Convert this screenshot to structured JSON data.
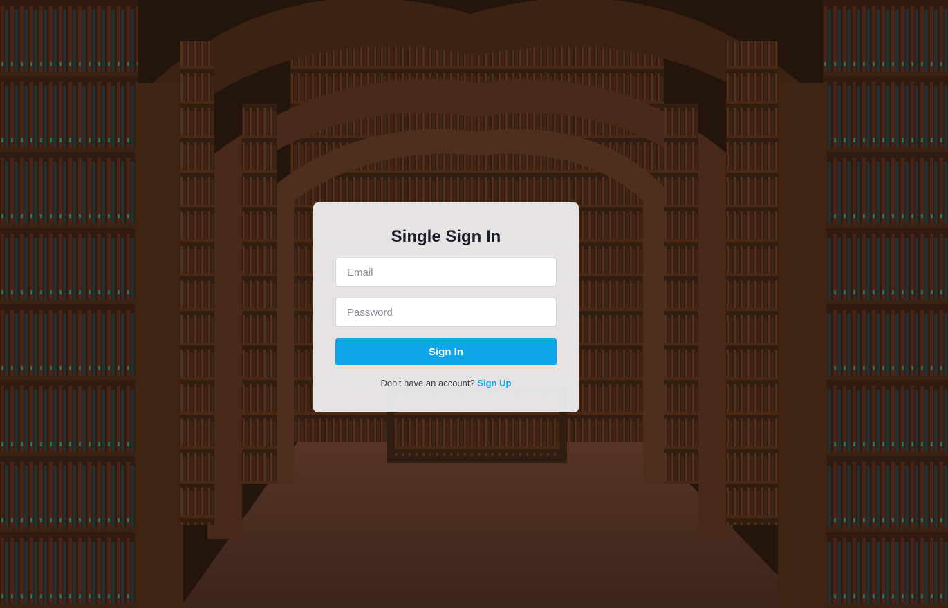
{
  "login": {
    "title": "Single Sign In",
    "email_placeholder": "Email",
    "email_value": "",
    "password_placeholder": "Password",
    "password_value": "",
    "submit_label": "Sign In",
    "signup_prompt": "Don't have an account?",
    "signup_link": "Sign Up"
  },
  "colors": {
    "accent": "#0ea5e9",
    "title_text": "#1c2130",
    "card_background": "#f0f0f0"
  }
}
